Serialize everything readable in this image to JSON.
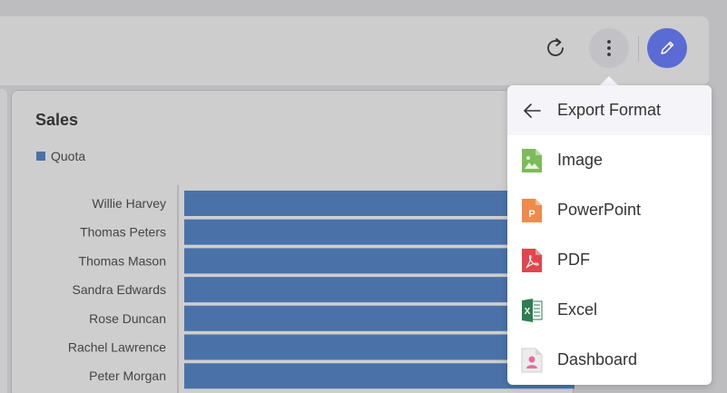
{
  "toolbar": {
    "refresh_icon": "refresh-icon",
    "more_icon": "more-vertical-icon",
    "edit_icon": "pencil-icon",
    "accent": "#5b6bd5"
  },
  "card": {
    "title": "Sales",
    "legend": "Quota"
  },
  "chart_data": {
    "type": "bar",
    "orientation": "horizontal",
    "categories": [
      "Willie Harvey",
      "Thomas Peters",
      "Thomas Mason",
      "Sandra Edwards",
      "Rose Duncan",
      "Rachel Lawrence",
      "Peter Morgan"
    ],
    "series": [
      {
        "name": "Quota",
        "color": "#4a72a8",
        "values": [
          1,
          1,
          1,
          1,
          1,
          1,
          1
        ]
      }
    ],
    "grid": false,
    "legend_position": "top-left"
  },
  "menu": {
    "header": "Export Format",
    "items": [
      {
        "label": "Image",
        "icon": "image-file-icon",
        "color": "#7cbb5a"
      },
      {
        "label": "PowerPoint",
        "icon": "powerpoint-file-icon",
        "color": "#f08a4b"
      },
      {
        "label": "PDF",
        "icon": "pdf-file-icon",
        "color": "#e0464e"
      },
      {
        "label": "Excel",
        "icon": "excel-file-icon",
        "color": "#2e7d52"
      },
      {
        "label": "Dashboard",
        "icon": "dashboard-file-icon",
        "color": "#e86aa0"
      }
    ]
  }
}
